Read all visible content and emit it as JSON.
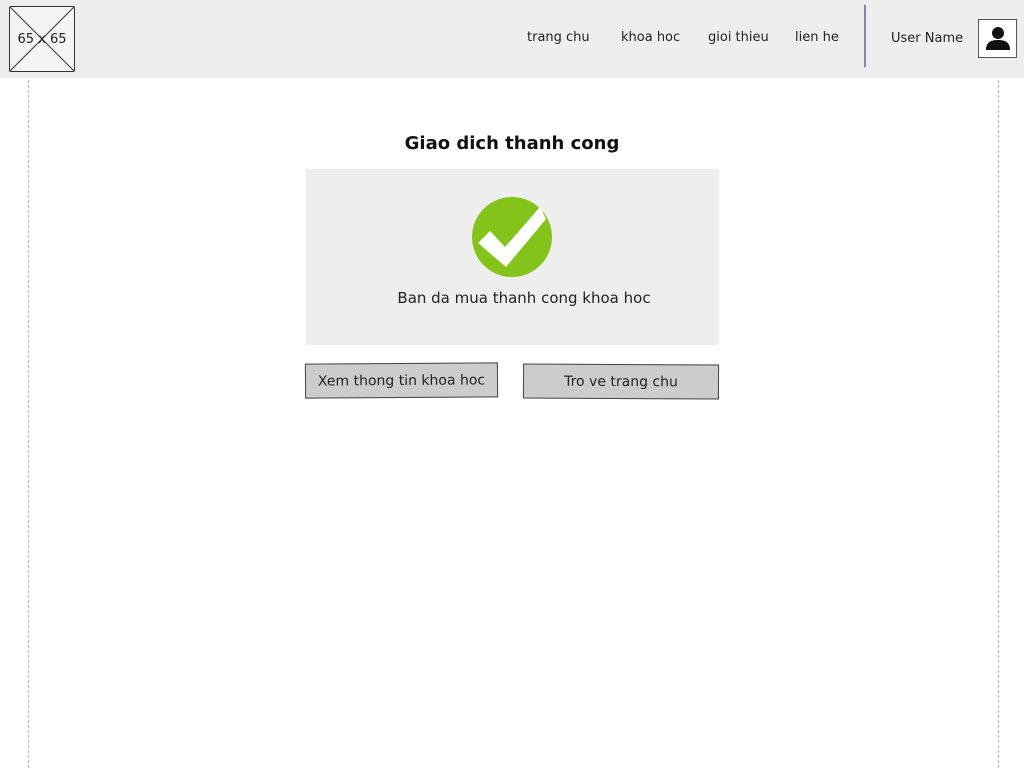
{
  "header": {
    "logo_text": "65 x 65",
    "nav": [
      {
        "label": "trang chu"
      },
      {
        "label": "khoa hoc"
      },
      {
        "label": "gioi thieu"
      },
      {
        "label": "lien he"
      }
    ],
    "user_name": "User Name",
    "avatar_icon": "user-icon"
  },
  "main": {
    "title": "Giao dich thanh cong",
    "status_icon": "check-circle-icon",
    "message": "Ban da mua thanh cong khoa hoc",
    "buttons": {
      "view_course": "Xem thong tin khoa hoc",
      "back_home": "Tro ve trang chu"
    }
  },
  "colors": {
    "header_bg": "#eeeeee",
    "panel_bg": "#eeeeee",
    "success_green": "#84c31a",
    "button_bg": "#cccccc",
    "divider": "#7f86b3"
  }
}
